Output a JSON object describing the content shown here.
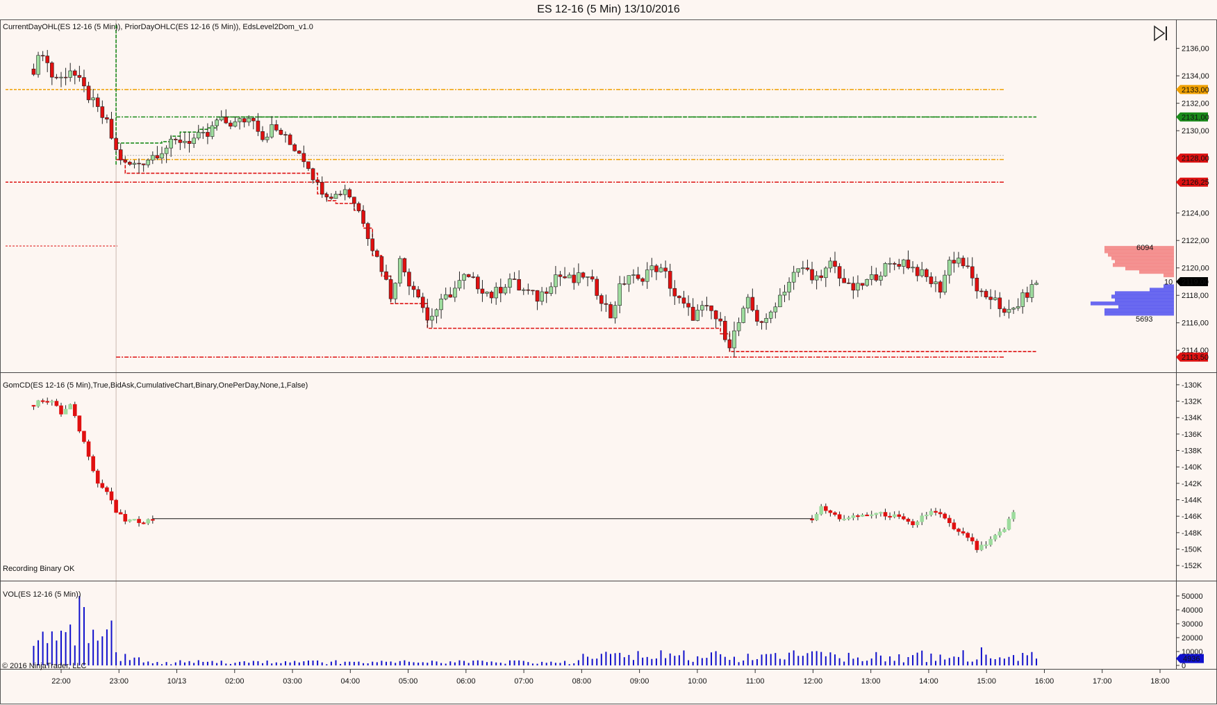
{
  "window": {
    "title": "ES 12-16 (5 Min)  13/10/2016",
    "copyright": "© 2016 NinjaTrader, LLC",
    "play_icon": "skip-forward-icon"
  },
  "chart_data": [
    {
      "type": "candlestick",
      "pane": "price",
      "indicator_label": "CurrentDayOHL(ES 12-16 (5 Min)), PriorDayOHLC(ES 12-16 (5 Min)), EdsLevel2Dom_v1.0",
      "x_ticks": [
        "22:00",
        "23:00",
        "10/13",
        "02:00",
        "03:00",
        "04:00",
        "05:00",
        "06:00",
        "07:00",
        "08:00",
        "09:00",
        "10:00",
        "11:00",
        "12:00",
        "13:00",
        "14:00",
        "15:00",
        "16:00",
        "17:00",
        "18:00"
      ],
      "y_ticks": [
        "2136,00",
        "2134,00",
        "2132,00",
        "2130,00",
        "2124,00",
        "2122,00",
        "2120,00",
        "2118,00",
        "2116,00",
        "2114,00"
      ],
      "ylim": [
        2113,
        2137.5
      ],
      "price_markers": [
        {
          "label": "2133,00",
          "value": 2133.0,
          "color": "#f0a000"
        },
        {
          "label": "2131,00",
          "value": 2131.0,
          "color": "#1a8a1a"
        },
        {
          "label": "2128,00",
          "value": 2128.0,
          "color": "#dd1111"
        },
        {
          "label": "2126,25",
          "value": 2126.25,
          "color": "#dd1111"
        },
        {
          "label": "2119,00",
          "value": 2119.0,
          "color": "#000000"
        },
        {
          "label": "2113,50",
          "value": 2113.5,
          "color": "#dd1111"
        }
      ],
      "levels": [
        {
          "name": "prior-day-high",
          "value": 2133.0,
          "color": "#f0a000"
        },
        {
          "name": "current-day-high",
          "value": 2131.0,
          "color": "#1a8a1a"
        },
        {
          "name": "prior-day-close",
          "value": 2127.9,
          "color": "#f0a000"
        },
        {
          "name": "prior-day-low",
          "value": 2126.25,
          "color": "#dd1111"
        },
        {
          "name": "current-day-low",
          "value": 2113.5,
          "color": "#dd1111"
        }
      ],
      "close_path": [
        [
          "21:30",
          2134.5
        ],
        [
          "21:40",
          2135.8
        ],
        [
          "21:50",
          2134.0
        ],
        [
          "22:00",
          2133.8
        ],
        [
          "22:10",
          2134.5
        ],
        [
          "22:20",
          2133.5
        ],
        [
          "22:30",
          2132.5
        ],
        [
          "22:40",
          2131.5
        ],
        [
          "22:50",
          2130.5
        ],
        [
          "23:00",
          2128.5
        ],
        [
          "23:10",
          2127.5
        ],
        [
          "23:20",
          2127.5
        ],
        [
          "23:30",
          2127.8
        ],
        [
          "23:40",
          2128.2
        ],
        [
          "23:50",
          2128.6
        ],
        [
          "00:00",
          2129.0
        ],
        [
          "00:10",
          2129.3
        ],
        [
          "00:20",
          2129.3
        ],
        [
          "00:30",
          2129.5
        ],
        [
          "00:40",
          2129.6
        ],
        [
          "00:50",
          2130.7
        ],
        [
          "01:00",
          2130.6
        ],
        [
          "01:10",
          2130.5
        ],
        [
          "01:20",
          2130.8
        ],
        [
          "01:30",
          2131.0
        ],
        [
          "01:40",
          2129.5
        ],
        [
          "01:50",
          2130.2
        ],
        [
          "02:00",
          2129.8
        ],
        [
          "02:10",
          2129.0
        ],
        [
          "02:20",
          2128.5
        ],
        [
          "02:30",
          2127.5
        ],
        [
          "02:40",
          2126.0
        ],
        [
          "02:50",
          2125.5
        ],
        [
          "03:00",
          2125.3
        ],
        [
          "03:10",
          2125.8
        ],
        [
          "03:20",
          2124.8
        ],
        [
          "03:30",
          2123.5
        ],
        [
          "03:40",
          2121.5
        ],
        [
          "03:50",
          2120.0
        ],
        [
          "04:00",
          2118.0
        ],
        [
          "04:10",
          2120.5
        ],
        [
          "04:20",
          2119.0
        ],
        [
          "04:30",
          2118.2
        ],
        [
          "04:40",
          2116.2
        ],
        [
          "04:50",
          2117.0
        ],
        [
          "05:00",
          2117.8
        ],
        [
          "05:10",
          2118.5
        ],
        [
          "05:20",
          2119.3
        ],
        [
          "05:30",
          2119.0
        ],
        [
          "05:40",
          2118.5
        ],
        [
          "05:50",
          2118.0
        ],
        [
          "06:00",
          2118.5
        ],
        [
          "06:10",
          2119.2
        ],
        [
          "06:20",
          2118.5
        ],
        [
          "06:30",
          2118.2
        ],
        [
          "06:40",
          2117.8
        ],
        [
          "06:50",
          2118.5
        ],
        [
          "07:00",
          2119.5
        ],
        [
          "07:10",
          2119.3
        ],
        [
          "07:20",
          2119.0
        ],
        [
          "07:30",
          2119.5
        ],
        [
          "07:40",
          2118.8
        ],
        [
          "07:50",
          2117.8
        ],
        [
          "08:00",
          2116.5
        ],
        [
          "08:10",
          2118.5
        ],
        [
          "08:20",
          2119.5
        ],
        [
          "08:30",
          2119.0
        ],
        [
          "08:40",
          2119.8
        ],
        [
          "08:50",
          2120.0
        ],
        [
          "09:00",
          2119.5
        ],
        [
          "09:10",
          2118.0
        ],
        [
          "09:20",
          2117.2
        ],
        [
          "09:30",
          2116.5
        ],
        [
          "09:40",
          2117.0
        ],
        [
          "09:50",
          2116.8
        ],
        [
          "10:00",
          2115.8
        ],
        [
          "10:10",
          2114.5
        ],
        [
          "10:20",
          2116.0
        ],
        [
          "10:30",
          2117.5
        ],
        [
          "10:40",
          2116.3
        ],
        [
          "10:50",
          2116.0
        ],
        [
          "11:00",
          2117.5
        ],
        [
          "11:10",
          2118.5
        ],
        [
          "11:20",
          2119.5
        ],
        [
          "11:30",
          2120.0
        ],
        [
          "11:40",
          2119.5
        ],
        [
          "11:50",
          2119.0
        ],
        [
          "12:00",
          2120.5
        ],
        [
          "12:10",
          2119.5
        ],
        [
          "12:20",
          2118.5
        ],
        [
          "12:30",
          2118.5
        ],
        [
          "12:40",
          2119.0
        ],
        [
          "12:50",
          2119.5
        ],
        [
          "13:00",
          2120.0
        ],
        [
          "13:10",
          2120.3
        ],
        [
          "13:20",
          2120.5
        ],
        [
          "13:30",
          2120.0
        ],
        [
          "13:40",
          2119.5
        ],
        [
          "13:50",
          2119.0
        ],
        [
          "14:00",
          2118.5
        ],
        [
          "14:10",
          2120.5
        ],
        [
          "14:20",
          2120.7
        ],
        [
          "14:30",
          2119.8
        ],
        [
          "14:40",
          2118.5
        ],
        [
          "14:50",
          2117.5
        ],
        [
          "15:00",
          2118.0
        ],
        [
          "15:10",
          2116.5
        ],
        [
          "15:20",
          2117.0
        ],
        [
          "15:30",
          2117.8
        ],
        [
          "15:40",
          2118.5
        ],
        [
          "15:45",
          2119.0
        ]
      ],
      "dom_profile": {
        "ask_label": "6094",
        "bid_label": "5693",
        "mid_label": "10"
      }
    },
    {
      "type": "candlestick",
      "pane": "cumulative-delta",
      "indicator_label": "GomCD(ES 12-16 (5 Min),True,BidAsk,CumulativeChart,Binary,OnePerDay,None,1,False)",
      "status_text": "Recording Binary OK",
      "y_ticks": [
        "-130K",
        "-132K",
        "-134K",
        "-136K",
        "-138K",
        "-140K",
        "-142K",
        "-144K",
        "-146K",
        "-148K",
        "-150K",
        "-152K"
      ],
      "ylim": [
        -153000,
        -129500
      ],
      "close_path": [
        [
          "21:30",
          -132500
        ],
        [
          "21:40",
          -131800
        ],
        [
          "21:50",
          -132000
        ],
        [
          "22:00",
          -133500
        ],
        [
          "22:10",
          -132500
        ],
        [
          "22:20",
          -135500
        ],
        [
          "22:30",
          -138500
        ],
        [
          "22:40",
          -142000
        ],
        [
          "22:50",
          -143000
        ],
        [
          "23:00",
          -145500
        ],
        [
          "23:10",
          -146500
        ],
        [
          "23:20",
          -146600
        ],
        [
          "23:30",
          -146600
        ],
        [
          "23:40",
          -146400
        ],
        [
          "11:40",
          -146300
        ],
        [
          "11:50",
          -145000
        ],
        [
          "12:00",
          -145600
        ],
        [
          "12:10",
          -146200
        ],
        [
          "12:20",
          -146300
        ],
        [
          "12:30",
          -146000
        ],
        [
          "12:40",
          -145800
        ],
        [
          "12:50",
          -145700
        ],
        [
          "13:00",
          -145800
        ],
        [
          "13:10",
          -146000
        ],
        [
          "13:20",
          -146500
        ],
        [
          "13:30",
          -147200
        ],
        [
          "13:40",
          -146000
        ],
        [
          "13:50",
          -145500
        ],
        [
          "14:00",
          -145800
        ],
        [
          "14:10",
          -147000
        ],
        [
          "14:20",
          -148000
        ],
        [
          "14:30",
          -148500
        ],
        [
          "14:40",
          -150000
        ],
        [
          "14:50",
          -149500
        ],
        [
          "15:00",
          -148500
        ],
        [
          "15:10",
          -147500
        ],
        [
          "15:20",
          -145500
        ]
      ]
    },
    {
      "type": "bar",
      "pane": "volume",
      "indicator_label": "VOL(ES 12-16 (5 Min))",
      "y_ticks": [
        "50000",
        "40000",
        "30000",
        "20000",
        "10000",
        "0"
      ],
      "ylim": [
        0,
        55000
      ],
      "last_value_label": "4936",
      "last_value": 4936
    }
  ]
}
